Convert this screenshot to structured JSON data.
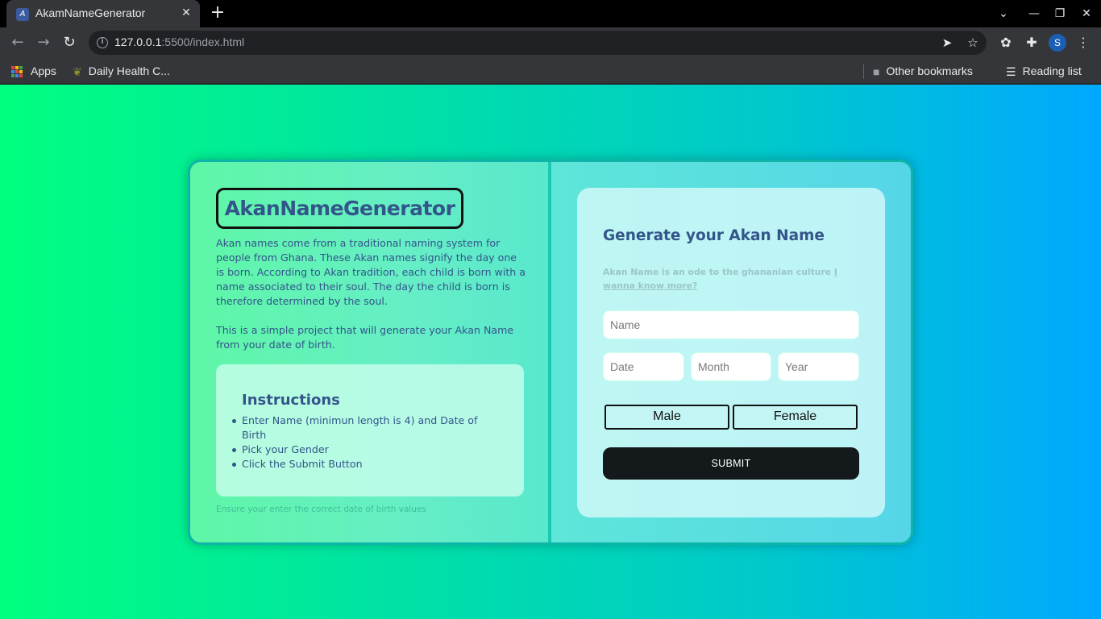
{
  "browser": {
    "tab_title": "AkamNameGenerator",
    "tab_favicon": "A",
    "url_host": "127.0.0.1",
    "url_rest": ":5500/index.html",
    "profile_initial": "S",
    "bookmarks": {
      "apps_label": "Apps",
      "item_1": "Daily Health C...",
      "other_bookmarks": "Other bookmarks",
      "reading_list": "Reading list"
    }
  },
  "page": {
    "brand": "AkanNameGenerator",
    "intro_p1": "Akan names come from a traditional naming system for people from Ghana. These Akan names signify the day one is born. According to Akan tradition, each child is born with a name associated to their soul. The day the child is born is therefore determined by the soul.",
    "intro_p2": "This is a simple project that will generate your Akan Name from your date of birth.",
    "instructions": {
      "title": "Instructions",
      "items": [
        "Enter Name (minimun length is 4) and Date of Birth",
        "Pick your Gender",
        "Click the Submit Button"
      ]
    },
    "footnote": "Ensure your enter the correct date of birth values",
    "form": {
      "title": "Generate your Akan Name",
      "subtitle": "Akan Name is an ode to the ghananian culture",
      "link_text": "I wanna know more?",
      "name_placeholder": "Name",
      "date_placeholder": "Date",
      "month_placeholder": "Month",
      "year_placeholder": "Year",
      "male_label": "Male",
      "female_label": "Female",
      "submit_label": "SUBMIT"
    }
  },
  "colors": {
    "accent_text": "#33558a",
    "submit_bg": "#141a1c",
    "bg_start": "#00ff80",
    "bg_end": "#00a8ff"
  }
}
